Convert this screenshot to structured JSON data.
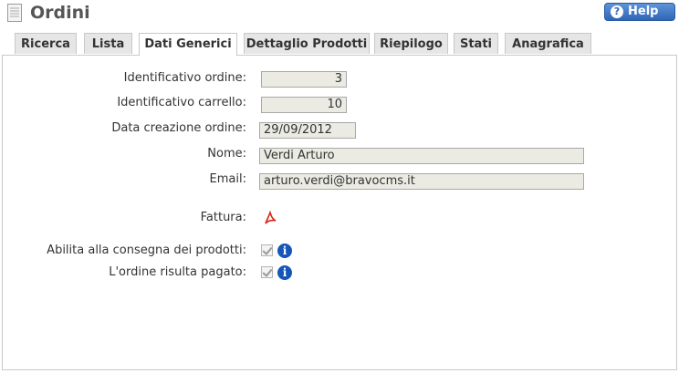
{
  "header": {
    "title": "Ordini",
    "help_label": "Help"
  },
  "tabs": [
    {
      "label": "Ricerca"
    },
    {
      "label": "Lista"
    },
    {
      "label": "Dati Generici"
    },
    {
      "label": "Dettaglio Prodotti"
    },
    {
      "label": "Riepilogo"
    },
    {
      "label": "Stati"
    },
    {
      "label": "Anagrafica"
    }
  ],
  "active_tab": "Dati Generici",
  "form": {
    "order_id_label": "Identificativo ordine:",
    "order_id_value": "3",
    "cart_id_label": "Identificativo carrello:",
    "cart_id_value": "10",
    "date_label": "Data creazione ordine:",
    "date_value": "29/09/2012",
    "name_label": "Nome:",
    "name_value": "Verdi Arturo",
    "email_label": "Email:",
    "email_value": "arturo.verdi@bravocms.it",
    "invoice_label": "Fattura:",
    "invoice_icon": "pdf-icon",
    "delivery_label": "Abilita alla consegna dei prodotti:",
    "delivery_checked": true,
    "paid_label": "L'ordine risulta pagato:",
    "paid_checked": true
  },
  "colors": {
    "accent": "#2f66b6",
    "field_bg": "#ebebe4",
    "tab_bg": "#e6e6e6"
  }
}
